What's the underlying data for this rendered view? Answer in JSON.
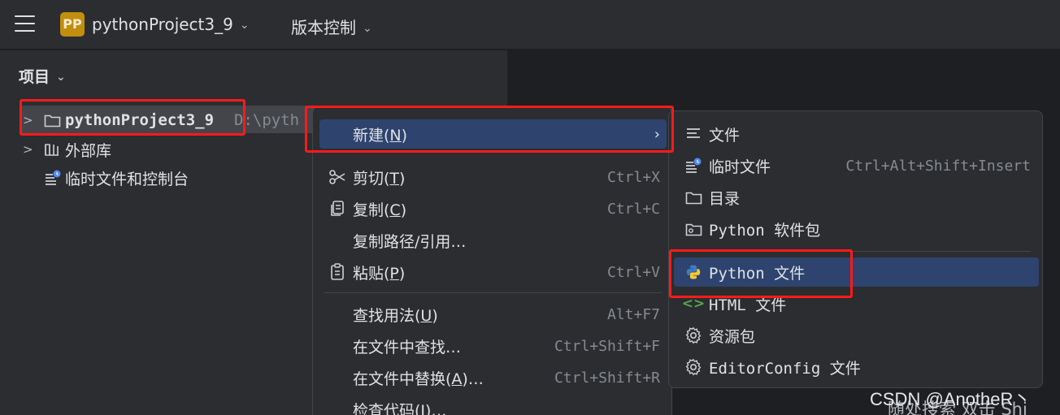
{
  "titlebar": {
    "project_badge": "PP",
    "project_name": "pythonProject3_9",
    "vcs_label": "版本控制"
  },
  "panel": {
    "title": "项目",
    "tree": [
      {
        "label": "pythonProject3_9",
        "path_hint": "D:\\pyth"
      },
      {
        "label": "外部库"
      },
      {
        "label": "临时文件和控制台"
      }
    ]
  },
  "context_menu": {
    "items": [
      {
        "label": "新建(N)",
        "mnemonic": "N",
        "pre": "新建(",
        "post": ")",
        "shortcut": "",
        "icon": "chevron-right-icon"
      },
      {
        "pre": "剪切(",
        "mnemonic": "T",
        "post": ")",
        "shortcut": "Ctrl+X",
        "icon": "scissors-icon"
      },
      {
        "pre": "复制(",
        "mnemonic": "C",
        "post": ")",
        "shortcut": "Ctrl+C",
        "icon": "copy-icon"
      },
      {
        "pre": "复制路径/引用…",
        "mnemonic": "",
        "post": "",
        "shortcut": "",
        "icon": ""
      },
      {
        "pre": "粘贴(",
        "mnemonic": "P",
        "post": ")",
        "shortcut": "Ctrl+V",
        "icon": "paste-icon"
      },
      {
        "pre": "查找用法(",
        "mnemonic": "U",
        "post": ")",
        "shortcut": "Alt+F7",
        "icon": ""
      },
      {
        "pre": "在文件中查找…",
        "mnemonic": "",
        "post": "",
        "shortcut": "Ctrl+Shift+F",
        "icon": ""
      },
      {
        "pre": "在文件中替换(",
        "mnemonic": "A",
        "post": ")…",
        "shortcut": "Ctrl+Shift+R",
        "icon": ""
      },
      {
        "pre": "检查代码(",
        "mnemonic": "I",
        "post": ")…",
        "shortcut": "",
        "icon": ""
      }
    ]
  },
  "submenu": {
    "items": [
      {
        "label": "文件",
        "shortcut": "",
        "icon": "file-text-icon"
      },
      {
        "label": "临时文件",
        "shortcut": "Ctrl+Alt+Shift+Insert",
        "icon": "scratch-file-icon"
      },
      {
        "label": "目录",
        "shortcut": "",
        "icon": "folder-icon"
      },
      {
        "label": "Python 软件包",
        "shortcut": "",
        "icon": "python-package-icon"
      },
      {
        "label": "Python 文件",
        "shortcut": "",
        "icon": "python-icon"
      },
      {
        "label": "HTML 文件",
        "shortcut": "",
        "icon": "html-icon"
      },
      {
        "label": "资源包",
        "shortcut": "",
        "icon": "gear-icon"
      },
      {
        "label": "EditorConfig 文件",
        "shortcut": "",
        "icon": "gear-icon"
      }
    ]
  },
  "overlay": {
    "search_hint": "随处搜索   双击 Shi",
    "watermark": "CSDN @AnotheR丶"
  },
  "colors": {
    "accent_selection": "#2e436e",
    "highlight_box": "#ff1a1a",
    "badge": "#c28e0e"
  }
}
